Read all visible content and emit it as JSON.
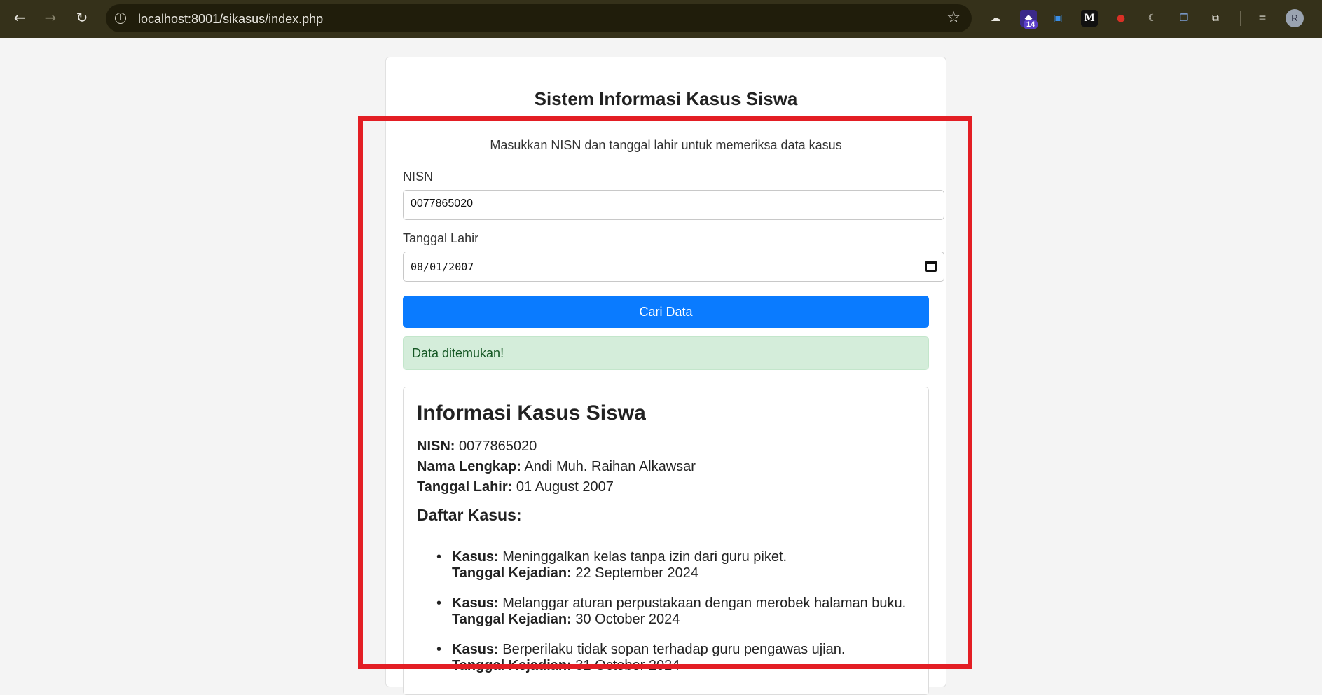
{
  "browser": {
    "url": "localhost:8001/sikasus/index.php",
    "extension_badge": "14",
    "profile_initial": "R",
    "icons": [
      "back-icon",
      "forward-icon",
      "reload-icon",
      "info-icon",
      "star-icon",
      "cloud-icon",
      "extension-icon",
      "translate-icon",
      "medium-icon",
      "tomato-icon",
      "moon-icon",
      "copy-icon",
      "puzzle-icon",
      "playlist-icon"
    ]
  },
  "page": {
    "title": "Sistem Informasi Kasus Siswa",
    "subtitle": "Masukkan NISN dan tanggal lahir untuk memeriksa data kasus",
    "form": {
      "nisn_label": "NISN",
      "nisn_value": "0077865020",
      "dob_label": "Tanggal Lahir",
      "dob_value": "08/01/2007",
      "submit_label": "Cari Data"
    },
    "alert": "Data ditemukan!",
    "result": {
      "heading": "Informasi Kasus Siswa",
      "nisn_label": "NISN:",
      "nisn_value": "0077865020",
      "name_label": "Nama Lengkap:",
      "name_value": "Andi Muh. Raihan Alkawsar",
      "dob_label": "Tanggal Lahir:",
      "dob_value": "01 August 2007",
      "cases_heading": "Daftar Kasus:",
      "case_label": "Kasus:",
      "date_label": "Tanggal Kejadian:",
      "cases": [
        {
          "description": "Meninggalkan kelas tanpa izin dari guru piket.",
          "date": "22 September 2024"
        },
        {
          "description": "Melanggar aturan perpustakaan dengan merobek halaman buku.",
          "date": "30 October 2024"
        },
        {
          "description": "Berperilaku tidak sopan terhadap guru pengawas ujian.",
          "date": "31 October 2024"
        }
      ]
    }
  },
  "colors": {
    "highlight": "#e31e24",
    "primary_button": "#0a7bff",
    "success_bg": "#d4edda"
  }
}
